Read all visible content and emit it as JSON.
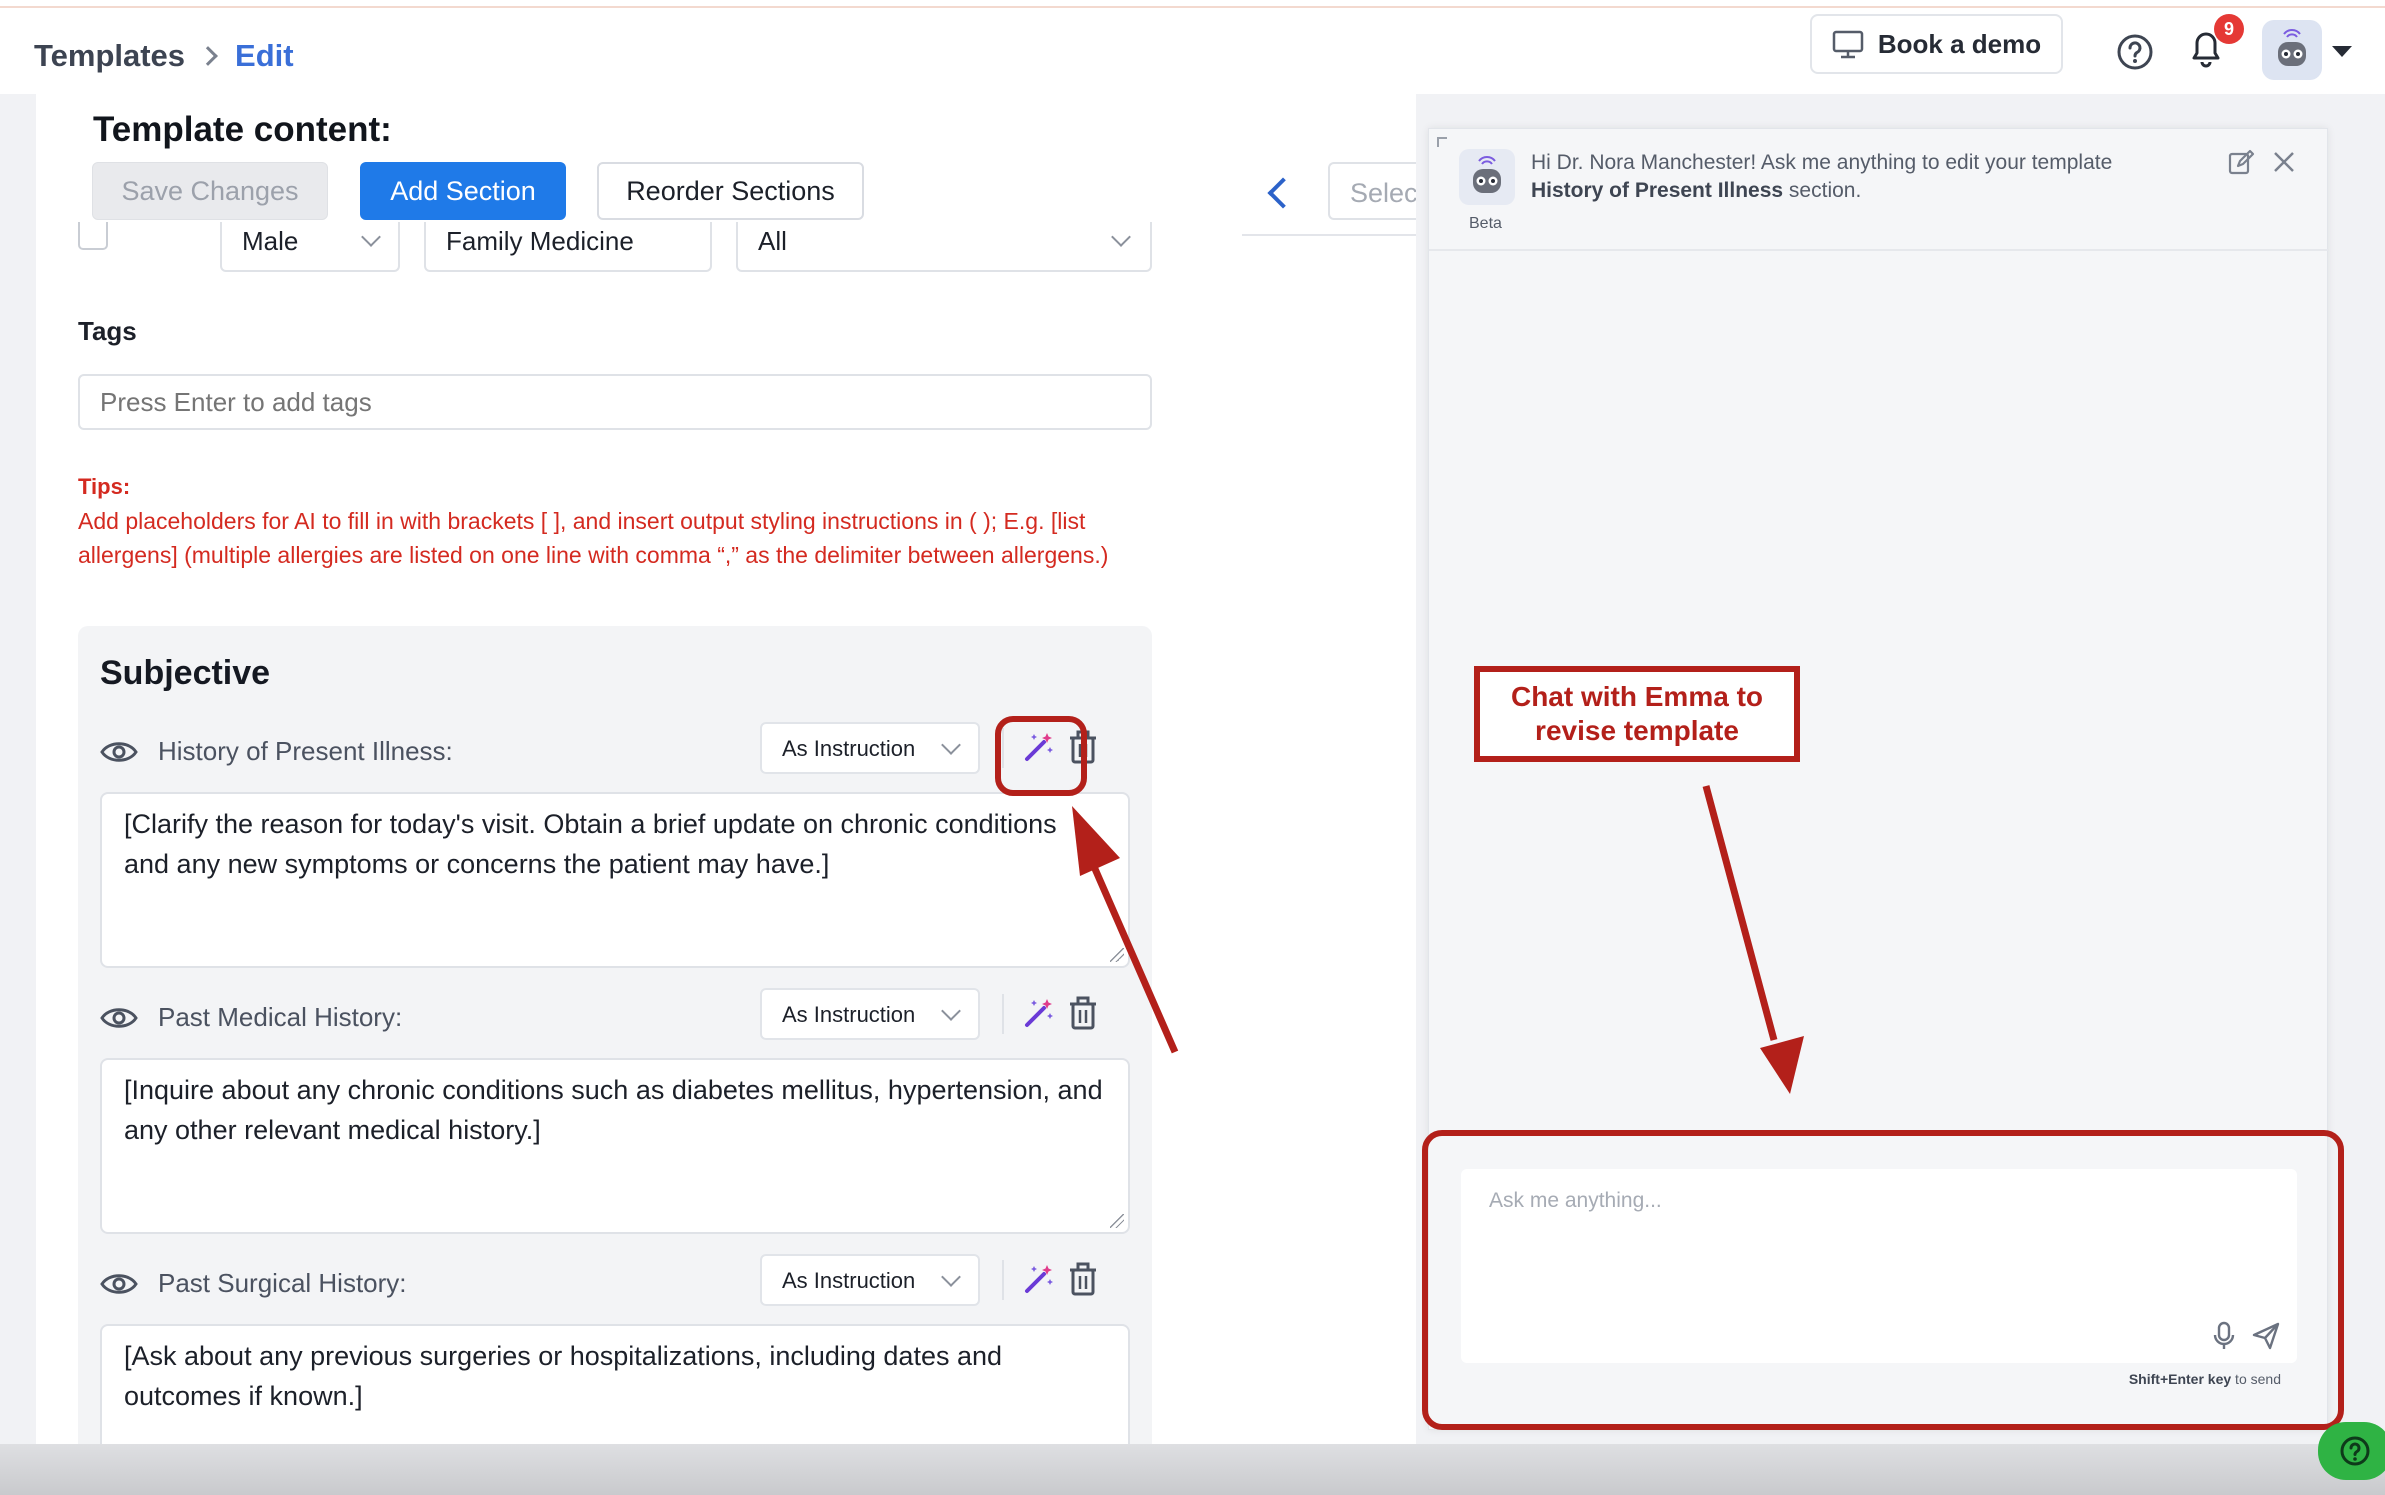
{
  "breadcrumb": {
    "parent": "Templates",
    "current": "Edit"
  },
  "header": {
    "book_demo": "Book a demo",
    "notification_count": "9"
  },
  "template": {
    "title": "Template content:",
    "save_label": "Save Changes",
    "add_label": "Add Section",
    "reorder_label": "Reorder Sections",
    "select_placeholder": "Select"
  },
  "filters": {
    "gender": "Male",
    "specialty": "Family Medicine",
    "visit": "All"
  },
  "tags": {
    "label": "Tags",
    "placeholder": "Press Enter to add tags"
  },
  "tips": {
    "heading": "Tips:",
    "text": "Add placeholders for AI to fill in with brackets [ ], and insert output styling instructions in ( ); E.g. [list allergens] (multiple allergies are listed on one line with comma “,” as the delimiter between allergens.)"
  },
  "section": {
    "title": "Subjective",
    "fields": [
      {
        "label": "History of Present Illness:",
        "mode": "As Instruction",
        "text": "[Clarify the reason for today's visit. Obtain a brief update on chronic conditions and any new symptoms or concerns the patient may have.]"
      },
      {
        "label": "Past Medical History:",
        "mode": "As Instruction",
        "text": "[Inquire about any chronic conditions such as diabetes mellitus, hypertension, and any other relevant medical history.]"
      },
      {
        "label": "Past Surgical History:",
        "mode": "As Instruction",
        "text": "[Ask about any previous surgeries or hospitalizations, including dates and outcomes if known.]"
      }
    ]
  },
  "chat": {
    "beta": "Beta",
    "greeting_prefix": "Hi Dr. Nora Manchester! Ask me anything to edit your template",
    "greeting_section": "History of Present Illness",
    "greeting_suffix": " section.",
    "input_placeholder": "Ask me anything...",
    "hint_key": "Shift+Enter key",
    "hint_text": " to send"
  },
  "annotation": {
    "label": "Chat with Emma to revise template",
    "color": "#b3201a"
  },
  "colors": {
    "primary": "#1f7ae8",
    "tips": "#d42a20",
    "help": "#2fb344"
  },
  "icons": [
    "monitor-icon",
    "help-circle-icon",
    "bell-icon",
    "robot-avatar-icon",
    "eye-icon",
    "magic-wand-icon",
    "trash-icon",
    "edit-icon",
    "close-icon",
    "microphone-icon",
    "send-icon"
  ]
}
